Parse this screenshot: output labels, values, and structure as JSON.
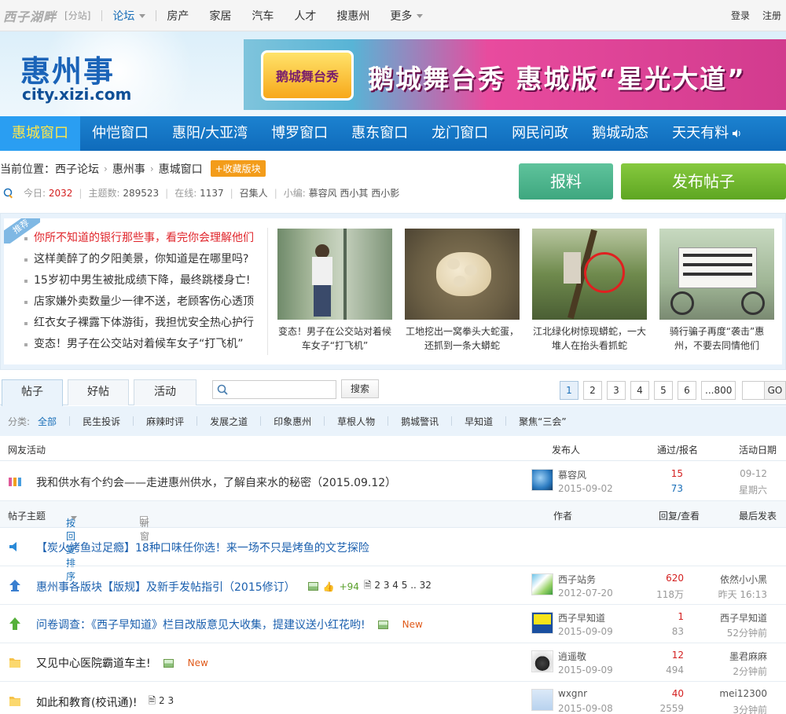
{
  "topbar": {
    "logo": "西子湖畔",
    "fenzhan": "[分站]",
    "nav": [
      {
        "label": "论坛",
        "dropdown": true,
        "active": true
      },
      {
        "label": "房产"
      },
      {
        "label": "家居"
      },
      {
        "label": "汽车"
      },
      {
        "label": "人才"
      },
      {
        "label": "搜惠州"
      },
      {
        "label": "更多",
        "dropdown": true
      }
    ],
    "login": "登录",
    "register": "注册"
  },
  "header": {
    "site_title": "惠州事",
    "site_domain": "city.xizi.com",
    "banner_logo": "鹅城舞台秀",
    "banner_text": "鹅城舞台秀  惠城版“星光大道”"
  },
  "mainnav": [
    "惠城窗口",
    "仲恺窗口",
    "惠阳/大亚湾",
    "博罗窗口",
    "惠东窗口",
    "龙门窗口",
    "网民问政",
    "鹅城动态",
    "天天有料"
  ],
  "info": {
    "location_label": "当前位置：",
    "crumbs": [
      "西子论坛",
      "惠州事",
      "惠城窗口"
    ],
    "fav_button": "+收藏版块",
    "today_label": "今日:",
    "today_value": "2032",
    "topics_label": "主题数:",
    "topics_value": "289523",
    "online_label": "在线:",
    "online_value": "1137",
    "recruit": "召集人",
    "editor_label": "小编:",
    "editors": "慕容风  西小其  西小影",
    "baoliao_button": "报料",
    "post_button": "发布帖子"
  },
  "recommend": {
    "tag": "推荐",
    "headlines": [
      "你所不知道的银行那些事，看完你会理解他们",
      "这样美醉了的夕阳美景，你知道是在哪里吗?",
      "15岁初中男生被批成绩下降，最终跳楼身亡!",
      "店家嫌外卖数量少一律不送，老顾客伤心透顶",
      "红衣女子裸露下体游街，我担忧安全热心护行",
      "变态！男子在公交站对着候车女子“打飞机”"
    ],
    "photos": [
      {
        "cap1": "变态！男子在公交站对着候",
        "cap2": "车女子“打飞机”"
      },
      {
        "cap1": "工地挖出一窝拳头大蛇蛋，",
        "cap2": "还抓到一条大蟒蛇"
      },
      {
        "cap1": "江北绿化树惊现蟒蛇，一大",
        "cap2": "堆人在抬头看抓蛇"
      },
      {
        "cap1": "骑行骗子再度“袭击”惠",
        "cap2": "州，不要去同情他们"
      }
    ]
  },
  "tabs": [
    "帖子",
    "好帖",
    "活动"
  ],
  "search": {
    "placeholder": "",
    "button": "搜索"
  },
  "pager": {
    "pages": [
      "1",
      "2",
      "3",
      "4",
      "5",
      "6",
      "...800"
    ],
    "go": "GO"
  },
  "categories": {
    "label": "分类:",
    "items": [
      "全部",
      "民生投诉",
      "麻辣时评",
      "发展之道",
      "印象惠州",
      "草根人物",
      "鹅城警讯",
      "早知道",
      "聚焦“三会”"
    ]
  },
  "activity_head": {
    "col1": "网友活动",
    "col2": "发布人",
    "col3": "通过/报名",
    "col4": "活动日期"
  },
  "activity": {
    "title": "我和供水有个约会——走进惠州供水，了解自来水的秘密（2015.09.12）",
    "author": "慕容风",
    "date": "2015-09-02",
    "passed": "15",
    "signed": "73",
    "day": "09-12",
    "weekday": "星期六"
  },
  "posts_head": {
    "col1": "帖子主题",
    "sort": "按回复排序",
    "new_window": "新窗",
    "author": "作者",
    "reply": "回复/查看",
    "last": "最后发表"
  },
  "posts": [
    {
      "title": "【炭火烤鱼过足瘾】18种口味任你选！来一场不只是烤鱼的文艺探险"
    },
    {
      "title": "惠州事各版块【版规】及新手发帖指引（2015修订）",
      "score": "+94",
      "pages": "2 3 4 5 .. 32",
      "author": "西子站务",
      "date": "2012-07-20",
      "replies": "620",
      "views": "118万",
      "last_user": "依然小小黑",
      "last_time": "昨天  16:13"
    },
    {
      "title": "问卷调查：《西子早知道》栏目改版意见大收集，提建议送小红花哟!",
      "new": "New",
      "author": "西子早知道",
      "date": "2015-09-09",
      "replies": "1",
      "views": "83",
      "last_user": "西子早知道",
      "last_time": "52分钟前"
    },
    {
      "title": "又见中心医院霸道车主!",
      "new": "New",
      "author": "逍遥敬",
      "date": "2015-09-09",
      "replies": "12",
      "views": "494",
      "last_user": "墨君麻麻",
      "last_time": "2分钟前"
    },
    {
      "title": "如此和教育(校讯通)!",
      "pages": "2 3",
      "author": "wxgnr",
      "date": "2015-09-08",
      "replies": "40",
      "views": "2559",
      "last_user": "mei12300",
      "last_time": "3分钟前"
    }
  ],
  "colors": {
    "brand_blue": "#1a6fb8",
    "nav_active_text": "#ffe74a",
    "hot_red": "#e0262c",
    "post_green": "#5ea622"
  }
}
